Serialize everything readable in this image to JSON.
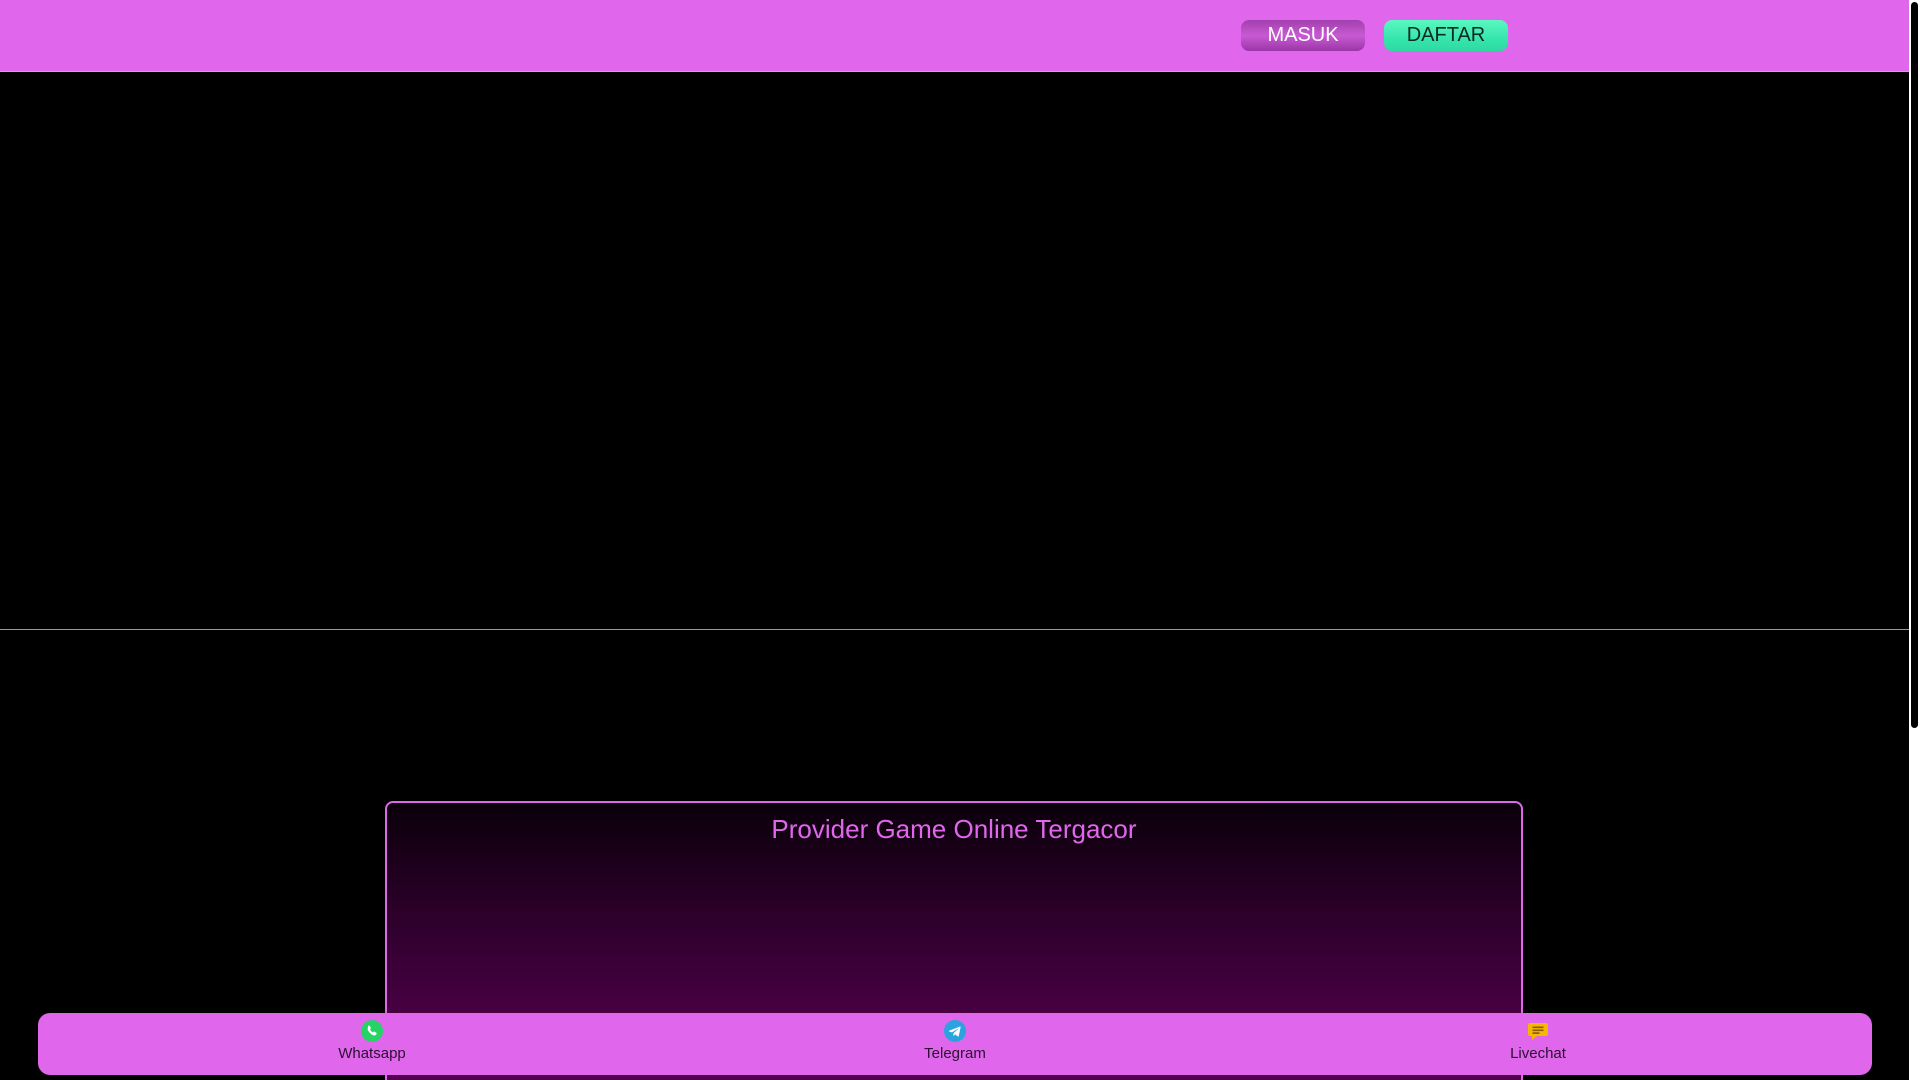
{
  "header": {
    "login_label": "MASUK",
    "register_label": "DAFTAR",
    "colors": {
      "background": "#e066ec",
      "login_button": "#b24bbf",
      "register_button": "#3ff0b6"
    }
  },
  "provider": {
    "title": "Provider Game Online Tergacor"
  },
  "bottom_bar": {
    "items": [
      {
        "label": "Whatsapp",
        "icon": "whatsapp-icon",
        "color": "#25d366"
      },
      {
        "label": "Telegram",
        "icon": "telegram-icon",
        "color": "#2aa3de"
      },
      {
        "label": "Livechat",
        "icon": "livechat-icon",
        "color": "#f5b800"
      }
    ]
  }
}
